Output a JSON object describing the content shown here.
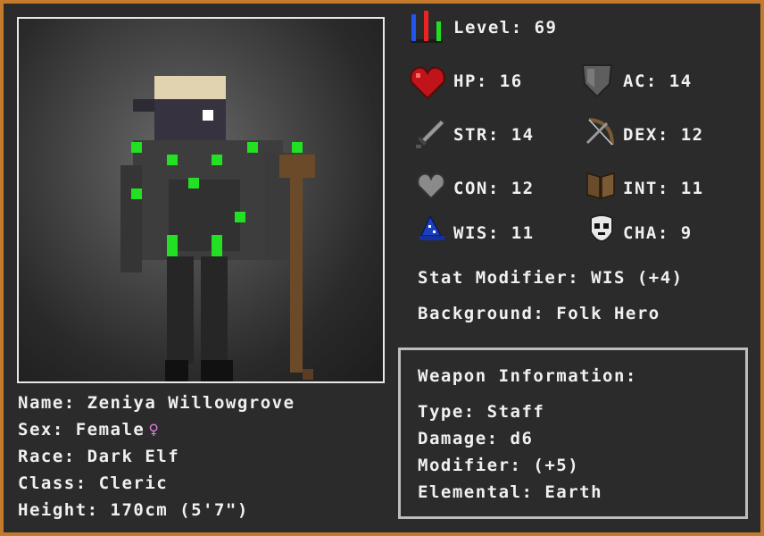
{
  "level": {
    "label": "Level:",
    "value": "69"
  },
  "stats": {
    "hp": {
      "label": "HP:",
      "value": "16"
    },
    "ac": {
      "label": "AC:",
      "value": "14"
    },
    "str": {
      "label": "STR:",
      "value": "14"
    },
    "dex": {
      "label": "DEX:",
      "value": "12"
    },
    "con": {
      "label": "CON:",
      "value": "12"
    },
    "int": {
      "label": "INT:",
      "value": "11"
    },
    "wis": {
      "label": "WIS:",
      "value": "11"
    },
    "cha": {
      "label": "CHA:",
      "value": "9"
    }
  },
  "stat_modifier": "Stat Modifier: WIS (+4)",
  "background": "Background: Folk Hero",
  "character": {
    "name": "Name: Zeniya Willowgrove",
    "sex": "Sex: Female",
    "sex_symbol": "♀",
    "race": "Race: Dark Elf",
    "class": "Class: Cleric",
    "height": "Height: 170cm (5'7\")"
  },
  "weapon": {
    "title": "Weapon Information:",
    "type": "Type: Staff",
    "damage": "Damage: d6",
    "modifier": "Modifier: (+5)",
    "elemental": "Elemental: Earth"
  },
  "icons": {
    "level": "bar-chart-icon",
    "hp": "heart-icon",
    "ac": "shield-icon",
    "str": "sword-icon",
    "dex": "bow-icon",
    "con": "grey-heart-icon",
    "int": "book-icon",
    "wis": "wizard-hat-icon",
    "cha": "skull-mask-icon"
  },
  "colors": {
    "background": "#2b2b2b",
    "border": "#c47a2c",
    "text": "#f0f0f0",
    "accent_green": "#22e022",
    "female_symbol": "#e080e0"
  }
}
